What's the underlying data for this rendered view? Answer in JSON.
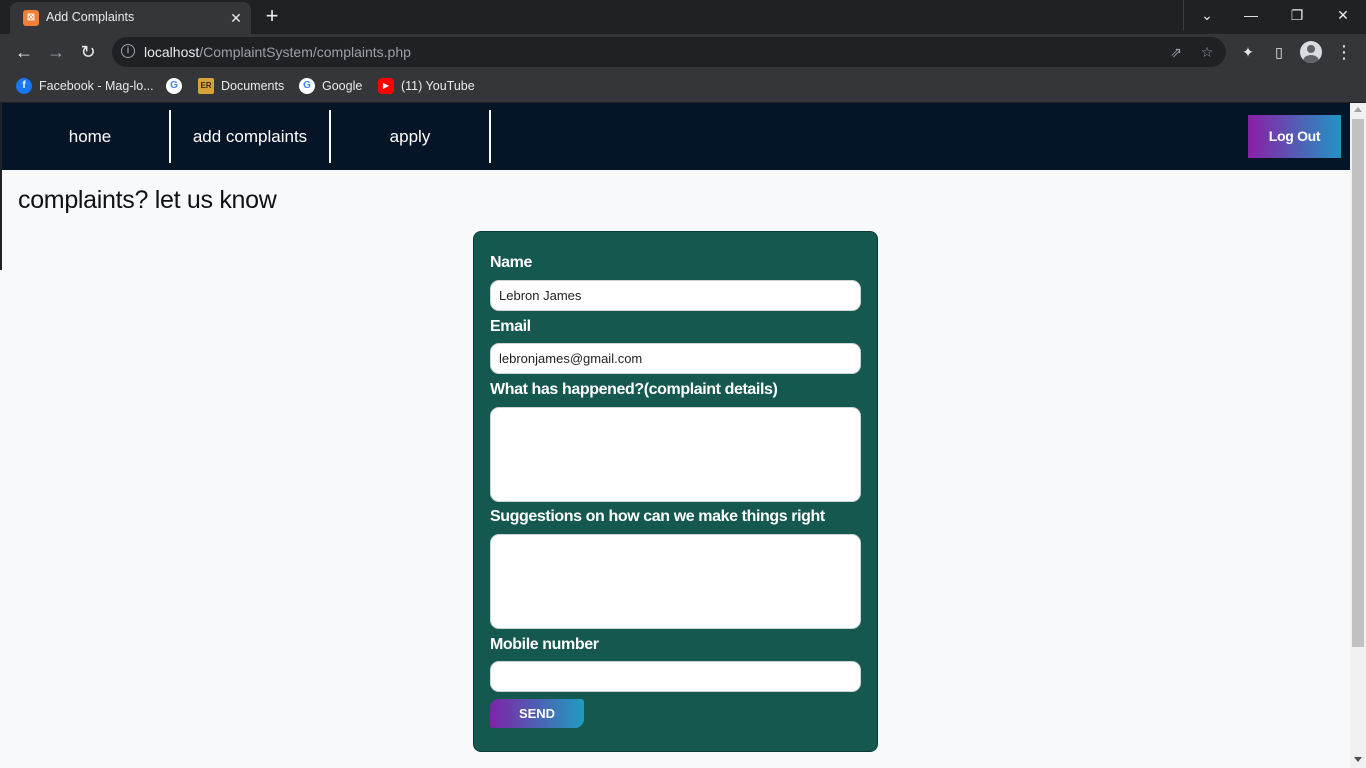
{
  "browser": {
    "tab": {
      "title": "Add Complaints",
      "favicon_text": "⊠",
      "close": "✕"
    },
    "new_tab": "+",
    "window_controls": {
      "dropdown": "⌄",
      "minimize": "—",
      "restore": "❐",
      "close": "✕"
    },
    "nav": {
      "back": "←",
      "forward": "→",
      "reload": "↻"
    },
    "address": {
      "host": "localhost",
      "path": "/ComplaintSystem/complaints.php",
      "info_icon": "i"
    },
    "toolbar_icons": {
      "share": "⇗",
      "star": "☆",
      "extensions": "✦",
      "side_panel": "▯",
      "menu": "⋮"
    },
    "bookmarks": [
      {
        "label": "Facebook - Mag-lo...",
        "icon": "facebook-icon",
        "icon_text": "f",
        "color": "#1877f2"
      },
      {
        "label": "",
        "icon": "google-icon",
        "icon_text": "G",
        "color": "#ffffff"
      },
      {
        "label": "Documents",
        "icon": "folder-icon",
        "icon_text": "ER",
        "color": "#d6a23c"
      },
      {
        "label": "Google",
        "icon": "google-icon",
        "icon_text": "G",
        "color": "#ffffff"
      },
      {
        "label": "(11) YouTube",
        "icon": "youtube-icon",
        "icon_text": "▶",
        "color": "#ff0000"
      }
    ]
  },
  "navbar": {
    "links": [
      "home",
      "add complaints",
      "apply"
    ],
    "logout": "Log Out"
  },
  "page": {
    "heading": "complaints? let us know"
  },
  "form": {
    "name": {
      "label": "Name",
      "value": "Lebron James"
    },
    "email": {
      "label": "Email",
      "value": "lebronjames@gmail.com"
    },
    "details": {
      "label": "What has happened?(complaint details)",
      "value": ""
    },
    "suggestions": {
      "label": "Suggestions on how can we make things right",
      "value": ""
    },
    "mobile": {
      "label": "Mobile number",
      "value": ""
    },
    "submit": "SEND"
  },
  "colors": {
    "navbar_bg": "#061427",
    "form_bg": "#155850",
    "button_gradient": [
      "#8a1fa6",
      "#2294c4"
    ]
  }
}
